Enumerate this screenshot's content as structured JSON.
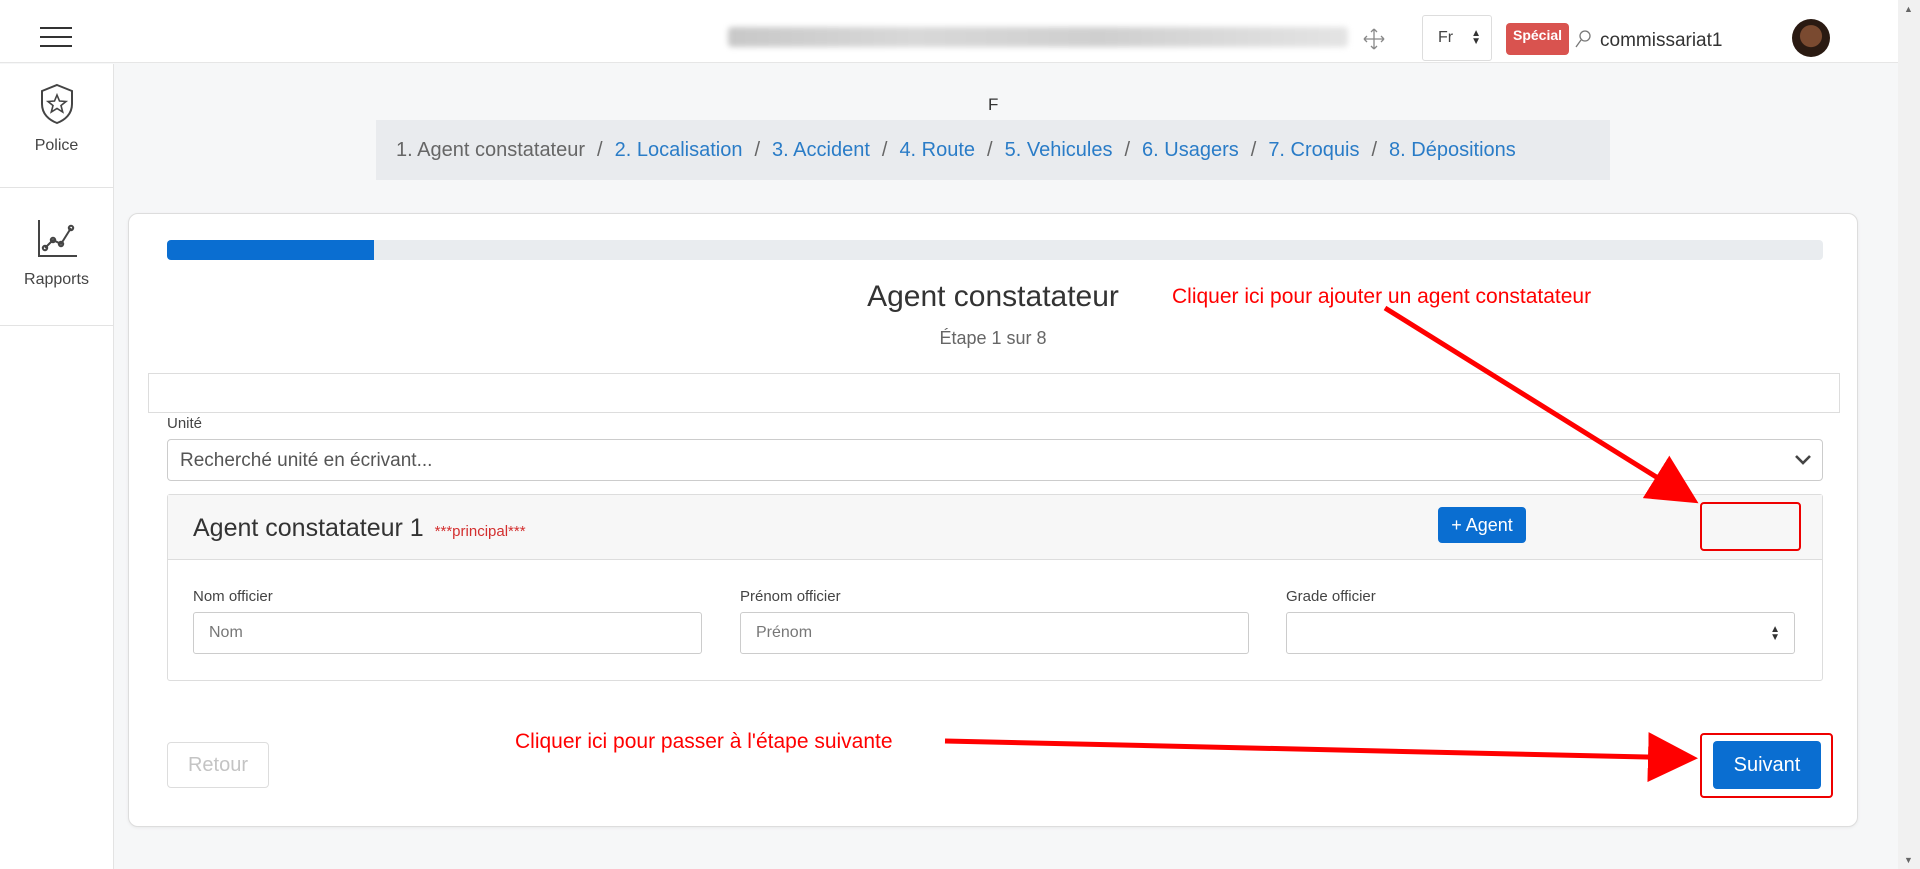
{
  "header": {
    "blurred_location": "Aire de santé MESSA Centre des Urgences de Yaoundé CURY",
    "lang": "Fr",
    "badge": "Spécial",
    "username": "commissariat1"
  },
  "sidebar": {
    "items": [
      {
        "label": "Police",
        "icon": "police-badge-icon"
      },
      {
        "label": "Rapports",
        "icon": "chart-line-icon"
      }
    ]
  },
  "page": {
    "letter": "F"
  },
  "breadcrumb": [
    {
      "label": "1. Agent constatateur",
      "active": true
    },
    {
      "label": "2. Localisation"
    },
    {
      "label": "3. Accident"
    },
    {
      "label": "4. Route"
    },
    {
      "label": "5. Vehicules"
    },
    {
      "label": "6. Usagers"
    },
    {
      "label": "7. Croquis"
    },
    {
      "label": "8. Dépositions"
    }
  ],
  "wizard": {
    "progress": 0.125,
    "title": "Agent constatateur",
    "subtitle": "Étape 1 sur 8",
    "unit_label": "Unité",
    "unit_placeholder": "Recherché unité en écrivant...",
    "agent_title": "Agent constatateur 1",
    "agent_principal": "***principal***",
    "add_agent_label": "+ Agent",
    "fields": {
      "nom_label": "Nom officier",
      "nom_placeholder": "Nom",
      "prenom_label": "Prénom officier",
      "prenom_placeholder": "Prénom",
      "grade_label": "Grade officier",
      "grade_value": ""
    },
    "back_label": "Retour",
    "next_label": "Suivant"
  },
  "annotations": {
    "add_agent_hint": "Cliquer ici pour ajouter un agent constatateur",
    "next_hint": "Cliquer ici pour passer à l'étape suivante"
  },
  "colors": {
    "primary": "#0a6ed1",
    "annotation": "#ff0000",
    "badge": "#d9534f"
  }
}
